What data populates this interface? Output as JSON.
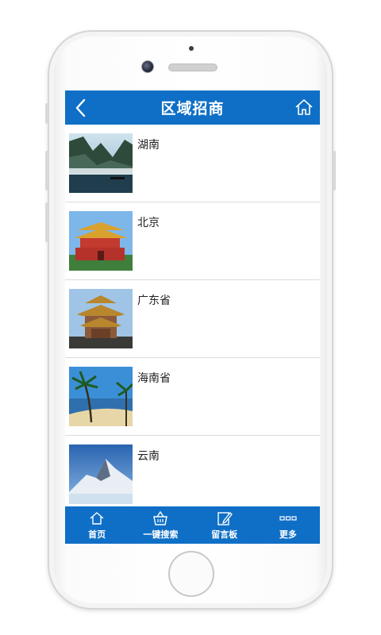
{
  "header": {
    "title": "区域招商",
    "back_icon": "chevron-left-icon",
    "home_icon": "home-icon"
  },
  "regions": [
    {
      "name": "湖南",
      "image": "misty-lake-mountains"
    },
    {
      "name": "北京",
      "image": "tiananmen-gate"
    },
    {
      "name": "广东省",
      "image": "chinese-pavilion-tower"
    },
    {
      "name": "海南省",
      "image": "palm-beach"
    },
    {
      "name": "云南",
      "image": "snow-mountain"
    }
  ],
  "tabbar": {
    "items": [
      {
        "label": "首页",
        "icon": "home-icon"
      },
      {
        "label": "一键搜索",
        "icon": "basket-icon"
      },
      {
        "label": "留言板",
        "icon": "edit-icon"
      },
      {
        "label": "更多",
        "icon": "more-icon"
      }
    ]
  },
  "colors": {
    "brand": "#0f6fc6"
  }
}
